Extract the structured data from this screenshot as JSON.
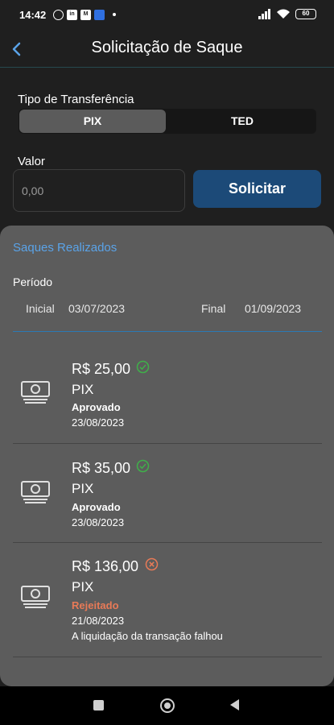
{
  "status_bar": {
    "time": "14:42",
    "battery": "60",
    "left_icons": [
      "alarm-icon",
      "linkedin-icon",
      "gmail-icon",
      "app-icon"
    ]
  },
  "header": {
    "title": "Solicitação de Saque",
    "back_icon": "chevron-left-icon"
  },
  "form": {
    "transfer_type_label": "Tipo de Transferência",
    "transfer_options": [
      "PIX",
      "TED"
    ],
    "selected_option": "PIX",
    "valor_label": "Valor",
    "valor_placeholder": "0,00",
    "submit_label": "Solicitar"
  },
  "withdrawals": {
    "title": "Saques Realizados",
    "period_label": "Período",
    "start_label": "Inicial",
    "start_date": "03/07/2023",
    "end_label": "Final",
    "end_date": "01/09/2023",
    "items": [
      {
        "amount": "R$ 25,00",
        "type": "PIX",
        "status": "Aprovado",
        "date": "23/08/2023",
        "reason": "",
        "status_icon": "check-circle-icon"
      },
      {
        "amount": "R$ 35,00",
        "type": "PIX",
        "status": "Aprovado",
        "date": "23/08/2023",
        "reason": "",
        "status_icon": "check-circle-icon"
      },
      {
        "amount": "R$ 136,00",
        "type": "PIX",
        "status": "Rejeitado",
        "date": "21/08/2023",
        "reason": "A liquidação da transação falhou",
        "status_icon": "x-circle-icon"
      }
    ]
  },
  "colors": {
    "accent": "#1c4a78",
    "link": "#5aa3e8",
    "approved_icon": "#3fb04a",
    "rejected": "#e87a57"
  },
  "nav_bar": {
    "icons": [
      "recents-square-icon",
      "home-circle-icon",
      "back-triangle-icon"
    ]
  }
}
